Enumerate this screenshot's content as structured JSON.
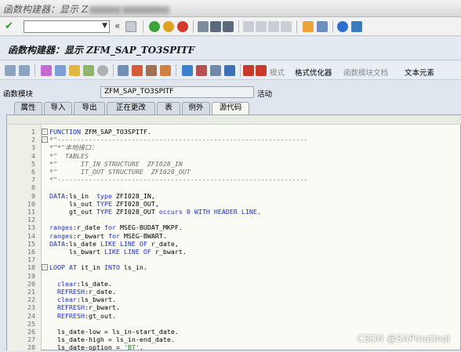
{
  "window": {
    "title": "函数构建器：显示 Z",
    "title_rest": "_SAP_"
  },
  "toolbar": {
    "command_value": "",
    "back_symbol": "«"
  },
  "app": {
    "title": "函数构建器：显示 ZFM_SAP_TO3SPITF"
  },
  "toolbar2": {
    "pattern": "模式",
    "pretty_printer": "格式优化器",
    "fm_doc": "函数模块文档",
    "text_elements": "文本元素"
  },
  "function_module": {
    "label": "函数模块",
    "value": "ZFM_SAP_TO3SPITF",
    "status": "活动"
  },
  "tabs": [
    "属性",
    "导入",
    "导出",
    "正在更改",
    "表",
    "例外",
    "源代码"
  ],
  "active_tab": "源代码",
  "code_lines": [
    {
      "n": "1",
      "fold": "⊟",
      "text": "FUNCTION ZFM_SAP_TO3SPITF.",
      "type": "kw"
    },
    {
      "n": "2",
      "fold": "⊟",
      "text": "*\"----------------------------------------------------------------",
      "type": "cm"
    },
    {
      "n": "3",
      "fold": "",
      "text": "*\"*\"本地接口：",
      "type": "cm"
    },
    {
      "n": "4",
      "fold": "",
      "text": "*\"  TABLES",
      "type": "cm"
    },
    {
      "n": "5",
      "fold": "",
      "text": "*\"      IT_IN STRUCTURE  ZFI028_IN",
      "type": "cm"
    },
    {
      "n": "6",
      "fold": "",
      "text": "*\"      IT_OUT STRUCTURE  ZFI028_OUT",
      "type": "cm"
    },
    {
      "n": "7",
      "fold": "",
      "text": "*\"----------------------------------------------------------------",
      "type": "cm"
    },
    {
      "n": "8",
      "fold": "",
      "text": "",
      "type": "tx"
    },
    {
      "n": "9",
      "fold": "",
      "text": "DATA:ls_in  type ZFI028_IN,",
      "type": "kw"
    },
    {
      "n": "10",
      "fold": "",
      "text": "     ls_out TYPE ZFI028_OUT,",
      "type": "tx"
    },
    {
      "n": "11",
      "fold": "",
      "text": "     gt_out TYPE ZFI028_OUT occurs 0 WITH HEADER LINE.",
      "type": "tx"
    },
    {
      "n": "12",
      "fold": "",
      "text": "",
      "type": "tx"
    },
    {
      "n": "13",
      "fold": "",
      "text": "ranges:r_date for MSEG-BUDAT_MKPF.",
      "type": "kw"
    },
    {
      "n": "14",
      "fold": "",
      "text": "ranges:r_bwart for MSEG-BWART.",
      "type": "kw"
    },
    {
      "n": "15",
      "fold": "",
      "text": "DATA:ls_date LIKE LINE OF r_date,",
      "type": "kw"
    },
    {
      "n": "16",
      "fold": "",
      "text": "     ls_bwart LIKE LINE OF r_bwart.",
      "type": "tx"
    },
    {
      "n": "17",
      "fold": "",
      "text": "",
      "type": "tx"
    },
    {
      "n": "18",
      "fold": "⊟",
      "text": "LOOP AT it_in INTO ls_in.",
      "type": "kw"
    },
    {
      "n": "19",
      "fold": "",
      "text": "",
      "type": "tx"
    },
    {
      "n": "20",
      "fold": "",
      "text": "  clear:ls_date.",
      "type": "kw"
    },
    {
      "n": "21",
      "fold": "",
      "text": "  REFRESH:r_date.",
      "type": "kw"
    },
    {
      "n": "22",
      "fold": "",
      "text": "  clear:ls_bwart.",
      "type": "kw"
    },
    {
      "n": "23",
      "fold": "",
      "text": "  REFRESH:r_bwart.",
      "type": "kw"
    },
    {
      "n": "24",
      "fold": "",
      "text": "  REFRESH:gt_out.",
      "type": "kw"
    },
    {
      "n": "25",
      "fold": "",
      "text": "",
      "type": "tx"
    },
    {
      "n": "26",
      "fold": "",
      "text": "  ls_date-low = ls_in-start_date.",
      "type": "tx"
    },
    {
      "n": "27",
      "fold": "",
      "text": "  ls_date-high = ls_in-end_date.",
      "type": "tx"
    },
    {
      "n": "28",
      "fold": "",
      "text": "  ls_date-option = 'BT'.",
      "type": "tx"
    }
  ],
  "watermark": "CSDN @SAPmatinal",
  "colors": {
    "keyword": "#1d32c8",
    "comment": "#6a6a6a",
    "bg": "#dfe6ee"
  }
}
